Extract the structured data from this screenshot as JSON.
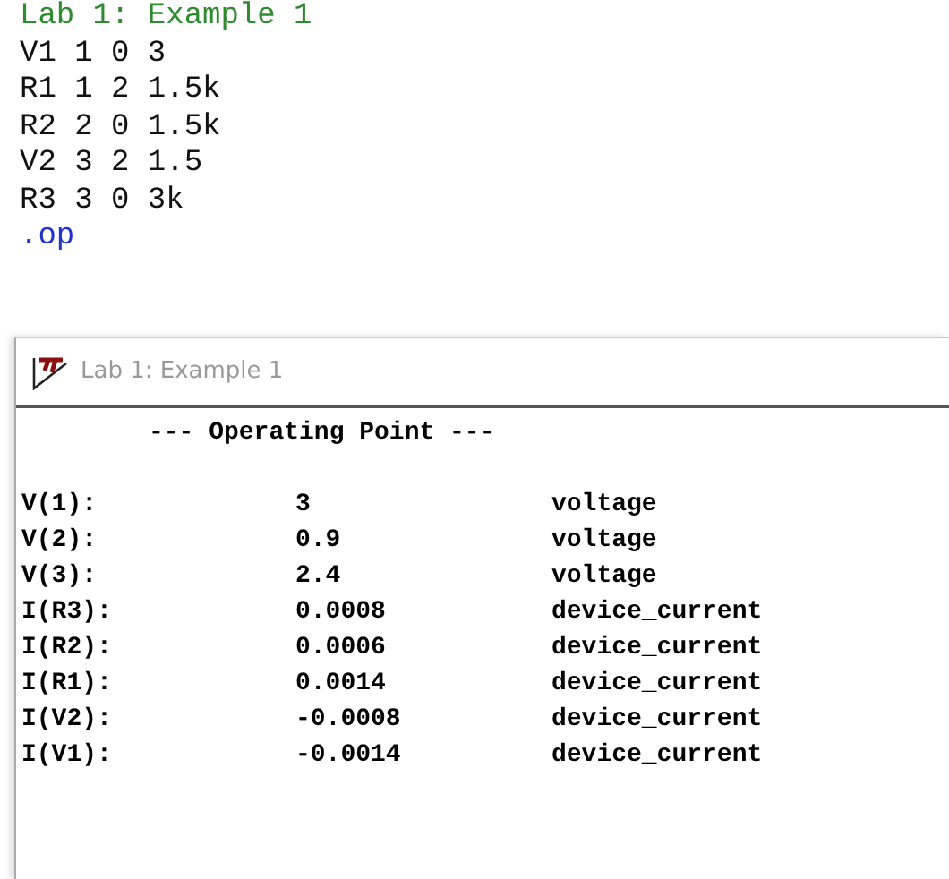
{
  "netlist": [
    {
      "kind": "comment",
      "text": "Lab 1: Example 1"
    },
    {
      "kind": "element",
      "text": "V1 1 0 3"
    },
    {
      "kind": "element",
      "text": "R1 1 2 1.5k"
    },
    {
      "kind": "element",
      "text": "R2 2 0 1.5k"
    },
    {
      "kind": "element",
      "text": "V2 3 2 1.5"
    },
    {
      "kind": "element",
      "text": "R3 3 0 3k"
    },
    {
      "kind": "directive",
      "text": ".op"
    }
  ],
  "window": {
    "title": "Lab 1: Example 1"
  },
  "output": {
    "heading": "--- Operating Point ---",
    "rows": [
      {
        "name": "V(1):",
        "value": "3",
        "type": "voltage"
      },
      {
        "name": "V(2):",
        "value": "0.9",
        "type": "voltage"
      },
      {
        "name": "V(3):",
        "value": "2.4",
        "type": "voltage"
      },
      {
        "name": "I(R3):",
        "value": "0.0008",
        "type": "device_current"
      },
      {
        "name": "I(R2):",
        "value": "0.0006",
        "type": "device_current"
      },
      {
        "name": "I(R1):",
        "value": "0.0014",
        "type": "device_current"
      },
      {
        "name": "I(V2):",
        "value": "-0.0008",
        "type": "device_current"
      },
      {
        "name": "I(V1):",
        "value": "-0.0014",
        "type": "device_current"
      }
    ]
  }
}
